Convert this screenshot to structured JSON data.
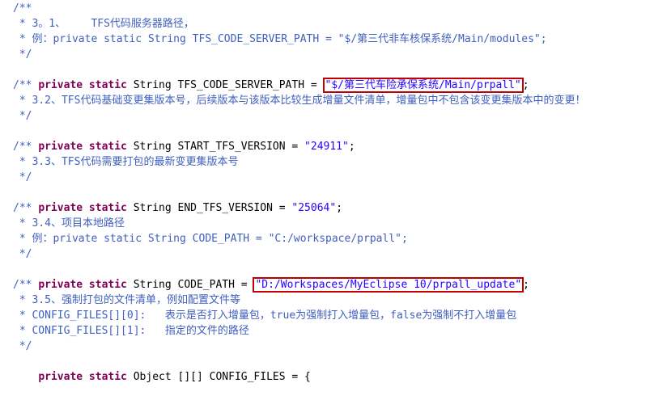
{
  "code": {
    "l1": "/**",
    "l2": " * 3。1、    TFS代码服务器路径，",
    "l3": " * 例：private static String TFS_CODE_SERVER_PATH = \"$/第三代非车核保系统/Main/modules\";",
    "l4": " */",
    "decl1": {
      "kw": "private static",
      "text": " String TFS_CODE_SERVER_PATH = ",
      "value": "\"$/第三代车险承保系统/Main/prpall\"",
      "end": ";"
    },
    "l6": "/**",
    "l7": " * 3.2、TFS代码基础变更集版本号，后续版本与该版本比较生成增量文件清单，增量包中不包含该变更集版本中的变更！",
    "l8": " */",
    "decl2": {
      "kw": "private static",
      "text": " String START_TFS_VERSION = ",
      "value": "\"24911\"",
      "end": ";"
    },
    "l10": "/**",
    "l11": " * 3.3、TFS代码需要打包的最新变更集版本号",
    "l12": " */",
    "decl3": {
      "kw": "private static",
      "text": " String END_TFS_VERSION = ",
      "value": "\"25064\"",
      "end": ";"
    },
    "l14": "/**",
    "l15": " * 3.4、项目本地路径",
    "l16": " * 例：private static String CODE_PATH = \"C:/workspace/prpall\";",
    "l17": " */",
    "decl4": {
      "kw": "private static",
      "text": " String CODE_PATH = ",
      "value": "\"D:/Workspaces/MyEclipse 10/prpall_update\"",
      "end": ";"
    },
    "l19": "/**",
    "l20": " * 3.5、强制打包的文件清单，例如配置文件等",
    "l21": " * CONFIG_FILES[][0]:   表示是否打入增量包，true为强制打入增量包，false为强制不打入增量包",
    "l22": " * CONFIG_FILES[][1]:   指定的文件的路径",
    "l23": " */",
    "decl5": {
      "kw": "private static",
      "text": " Object [][] CONFIG_FILES = {"
    }
  }
}
